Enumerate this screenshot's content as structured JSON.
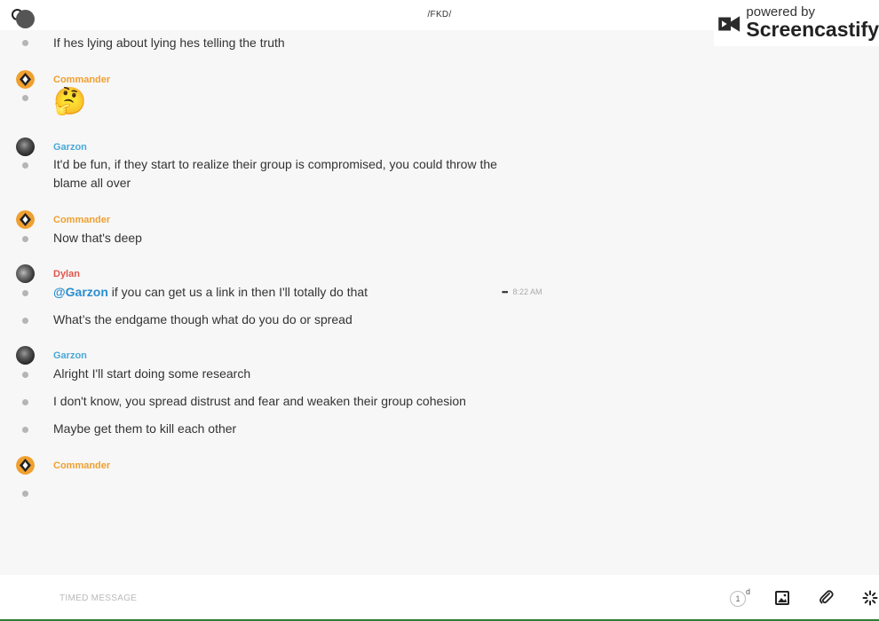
{
  "header": {
    "title": "/FKD/"
  },
  "watermark": {
    "top": "powered by",
    "brand": "Screencastify"
  },
  "colors": {
    "commander": "#f0a030",
    "garzon": "#4aa8d8",
    "dylan": "#e0564e",
    "mention": "#2a8fd0"
  },
  "messages": [
    {
      "lines": [
        "If hes lying about lying hes telling the truth"
      ]
    },
    {
      "author": "Commander",
      "lines": [
        "🤔"
      ]
    },
    {
      "author": "Garzon",
      "lines": [
        "It'd be fun, if they start to realize their group is compromised, you could throw the blame all over"
      ]
    },
    {
      "author": "Commander",
      "lines": [
        "Now that's deep"
      ]
    },
    {
      "author": "Dylan",
      "first_line": {
        "mention": "@Garzon",
        "text": " if you can get us a link in then I'll totally do that",
        "time": "8:22 AM"
      },
      "lines": [
        "What’s the endgame though what do you do or spread"
      ]
    },
    {
      "author": "Garzon",
      "lines": [
        "Alright I'll start doing some research",
        "I don't know, you spread distrust and fear and weaken their group cohesion",
        "Maybe get them to kill each other"
      ]
    },
    {
      "author": "Commander",
      "lines": [
        ""
      ]
    }
  ],
  "composer": {
    "timed_label": "TIMED MESSAGE",
    "timer_value": "1",
    "timer_unit": "d",
    "icons": [
      "image-icon",
      "paperclip-icon",
      "sparkle-icon"
    ]
  }
}
